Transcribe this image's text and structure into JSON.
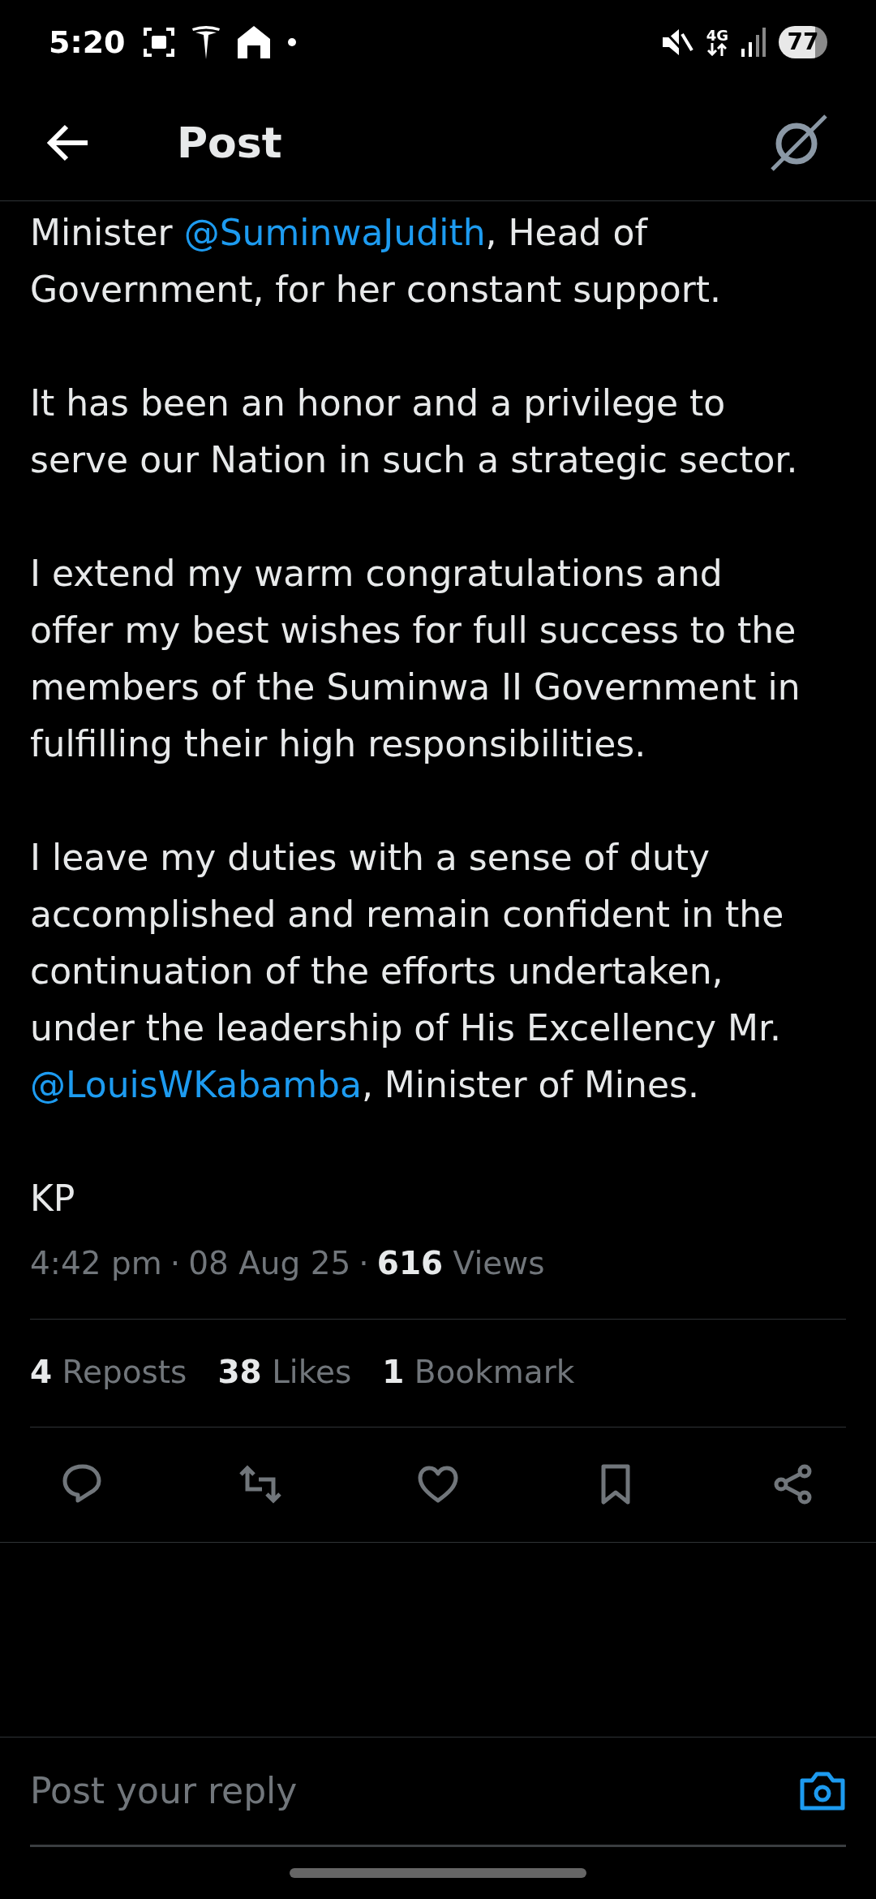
{
  "status_bar": {
    "time": "5:20",
    "battery": "77",
    "network": "4G"
  },
  "header": {
    "title": "Post"
  },
  "post": {
    "paragraphs": [
      [
        {
          "kind": "text",
          "text": "Minister "
        },
        {
          "kind": "mention",
          "text": "@SuminwaJudith"
        },
        {
          "kind": "text",
          "text": ", Head of Government, for her constant support."
        }
      ],
      [
        {
          "kind": "text",
          "text": "It has been an honor and a privilege to serve our Nation in such a strategic sector."
        }
      ],
      [
        {
          "kind": "text",
          "text": "I extend my warm congratulations and offer my best wishes for full success to the members of the Suminwa II Government in fulfilling their high responsibilities."
        }
      ],
      [
        {
          "kind": "text",
          "text": "I leave my duties with a sense of duty accomplished and remain confident in the continuation of the efforts undertaken, under the leadership of His Excellency Mr. "
        },
        {
          "kind": "mention",
          "text": "@LouisWKabamba"
        },
        {
          "kind": "text",
          "text": ", Minister of Mines."
        }
      ],
      [
        {
          "kind": "text",
          "text": "KP"
        }
      ]
    ],
    "time": "4:42 pm",
    "separators": [
      "·",
      "·"
    ],
    "date": "08 Aug 25",
    "views": {
      "count": "616",
      "label": "Views"
    },
    "stats": [
      {
        "count": "4",
        "label": "Reposts"
      },
      {
        "count": "38",
        "label": "Likes"
      },
      {
        "count": "1",
        "label": "Bookmark"
      }
    ]
  },
  "actions": [
    {
      "kind": "reply"
    },
    {
      "kind": "repost"
    },
    {
      "kind": "like"
    },
    {
      "kind": "bookmark"
    },
    {
      "kind": "share"
    }
  ],
  "reply_bar": {
    "placeholder": "Post your reply"
  }
}
